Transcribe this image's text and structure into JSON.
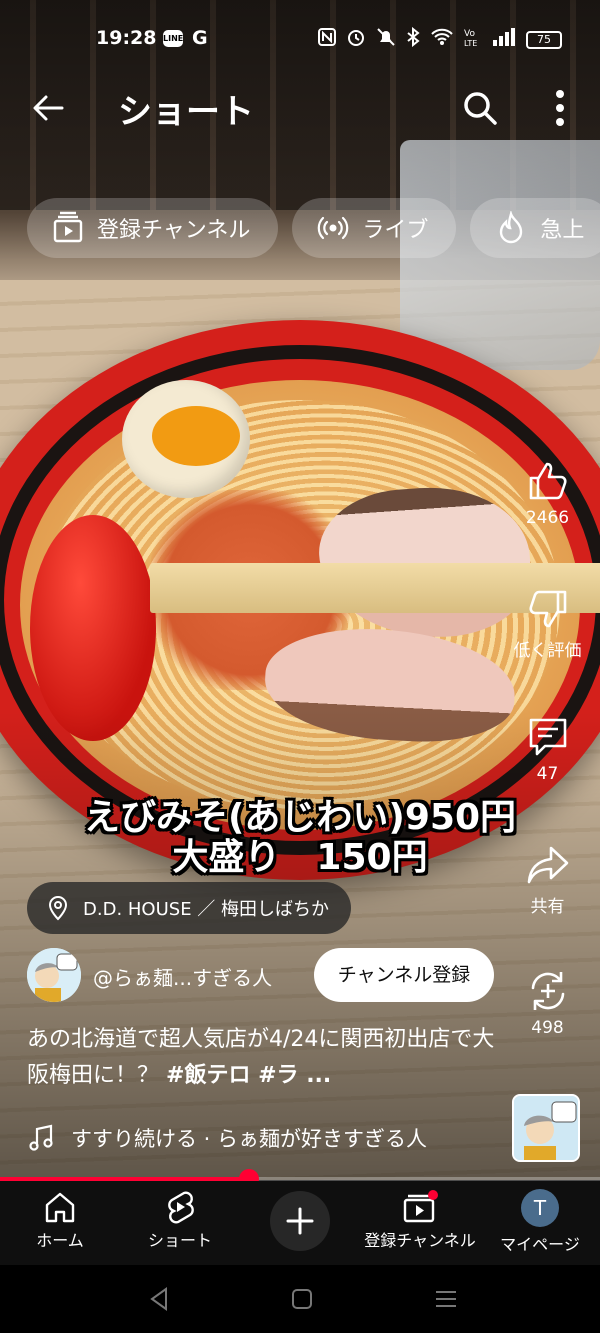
{
  "status_bar": {
    "time": "19:28",
    "line_label": "LINE",
    "g_label": "G",
    "battery": "75"
  },
  "header": {
    "title": "ショート"
  },
  "chips": [
    {
      "label": "登録チャンネル",
      "icon": "subscriptions-icon"
    },
    {
      "label": "ライブ",
      "icon": "live-icon"
    },
    {
      "label": "急上",
      "icon": "trending-icon"
    }
  ],
  "actions": {
    "like_count": "2466",
    "dislike_label": "低く評価",
    "comment_count": "47",
    "share_label": "共有",
    "remix_count": "498"
  },
  "video": {
    "overlay_line1": "えびみそ(あじわい)950円",
    "overlay_line2": "大盛り　150円",
    "location": "D.D. HOUSE ／ 梅田しばちか",
    "channel_name": "@らぁ麺...すぎる人",
    "subscribe_label": "チャンネル登録",
    "description_text": "あの北海道で超人気店が4/24に関西初出店で大阪梅田に！？",
    "description_tags": "#飯テロ #ラ ...",
    "music": "すすり続ける · らぁ麺が好きすぎる人",
    "progress": 0.415
  },
  "bottom_nav": {
    "home": "ホーム",
    "shorts": "ショート",
    "subscriptions": "登録チャンネル",
    "me": "マイページ",
    "me_initial": "T"
  },
  "colors": {
    "accent": "#ff0033",
    "nav_bg": "#0f0f0f"
  }
}
